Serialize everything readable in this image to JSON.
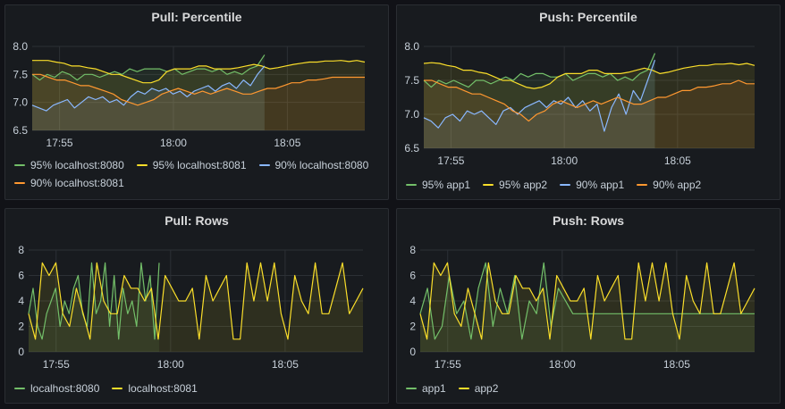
{
  "colors": {
    "green": "#73bf69",
    "yellow": "#fade2a",
    "cyan": "#8ab8ff",
    "orange": "#ff9830"
  },
  "chart_data": [
    {
      "type": "line",
      "title": "Pull: Percentile",
      "ylim": [
        6.5,
        8.0
      ],
      "y_ticks": [
        "8.0",
        "7.5",
        "7.0",
        "6.5"
      ],
      "y_tick_values": [
        8.0,
        7.5,
        7.0,
        6.5
      ],
      "x_ticks": [
        "17:55",
        "18:00",
        "18:05"
      ],
      "x_range_minutes": [
        -6.2,
        8.4
      ],
      "x_tick_minutes": [
        -5,
        0,
        5
      ],
      "grid": true,
      "legend_placement": "bottom",
      "series": [
        {
          "name": "95% localhost:8080",
          "color": "green",
          "x_end": 4.0,
          "values": [
            7.5,
            7.4,
            7.5,
            7.45,
            7.55,
            7.5,
            7.4,
            7.5,
            7.5,
            7.45,
            7.5,
            7.55,
            7.5,
            7.6,
            7.55,
            7.6,
            7.6,
            7.6,
            7.55,
            7.6,
            7.5,
            7.55,
            7.6,
            7.6,
            7.55,
            7.6,
            7.5,
            7.55,
            7.5,
            7.6,
            7.65,
            7.85
          ]
        },
        {
          "name": "95% localhost:8081",
          "color": "yellow",
          "x_end": 8.4,
          "values": [
            7.75,
            7.75,
            7.75,
            7.72,
            7.7,
            7.65,
            7.65,
            7.62,
            7.6,
            7.55,
            7.5,
            7.5,
            7.45,
            7.4,
            7.35,
            7.35,
            7.4,
            7.55,
            7.6,
            7.6,
            7.6,
            7.65,
            7.65,
            7.6,
            7.6,
            7.6,
            7.62,
            7.65,
            7.68,
            7.65,
            7.6,
            7.62,
            7.65,
            7.68,
            7.7,
            7.72,
            7.72,
            7.74,
            7.74,
            7.75,
            7.73,
            7.75,
            7.72
          ]
        },
        {
          "name": "90% localhost:8080",
          "color": "cyan",
          "x_end": 4.0,
          "values": [
            6.95,
            6.9,
            6.85,
            6.95,
            7.0,
            7.05,
            6.9,
            7.0,
            7.1,
            7.05,
            7.1,
            7.0,
            7.05,
            6.95,
            7.1,
            7.2,
            7.15,
            7.25,
            7.2,
            7.25,
            7.15,
            7.2,
            7.1,
            7.2,
            7.25,
            7.3,
            7.2,
            7.3,
            7.35,
            7.25,
            7.4,
            7.3,
            7.5,
            7.65
          ]
        },
        {
          "name": "90% localhost:8081",
          "color": "orange",
          "x_end": 8.4,
          "values": [
            7.5,
            7.5,
            7.45,
            7.4,
            7.4,
            7.35,
            7.3,
            7.3,
            7.25,
            7.2,
            7.15,
            7.05,
            7.0,
            6.95,
            7.0,
            7.05,
            7.15,
            7.2,
            7.25,
            7.2,
            7.15,
            7.2,
            7.15,
            7.2,
            7.25,
            7.2,
            7.15,
            7.15,
            7.2,
            7.25,
            7.25,
            7.3,
            7.35,
            7.35,
            7.4,
            7.4,
            7.42,
            7.45,
            7.45,
            7.45,
            7.45,
            7.45
          ]
        }
      ]
    },
    {
      "type": "line",
      "title": "Push: Percentile",
      "ylim": [
        6.5,
        8.0
      ],
      "y_ticks": [
        "8.0",
        "7.5",
        "7.0",
        "6.5"
      ],
      "y_tick_values": [
        8.0,
        7.5,
        7.0,
        6.5
      ],
      "x_ticks": [
        "17:55",
        "18:00",
        "18:05"
      ],
      "x_range_minutes": [
        -6.2,
        8.4
      ],
      "x_tick_minutes": [
        -5,
        0,
        5
      ],
      "grid": true,
      "legend_placement": "bottom",
      "series": [
        {
          "name": "95% app1",
          "color": "green",
          "x_end": 4.0,
          "values": [
            7.5,
            7.4,
            7.5,
            7.45,
            7.5,
            7.45,
            7.4,
            7.5,
            7.5,
            7.45,
            7.5,
            7.55,
            7.5,
            7.6,
            7.55,
            7.6,
            7.6,
            7.55,
            7.55,
            7.6,
            7.5,
            7.55,
            7.6,
            7.6,
            7.55,
            7.6,
            7.5,
            7.55,
            7.5,
            7.6,
            7.65,
            7.9
          ]
        },
        {
          "name": "95% app2",
          "color": "yellow",
          "x_end": 8.4,
          "values": [
            7.75,
            7.76,
            7.75,
            7.72,
            7.7,
            7.65,
            7.65,
            7.62,
            7.6,
            7.55,
            7.5,
            7.5,
            7.45,
            7.4,
            7.38,
            7.4,
            7.45,
            7.55,
            7.6,
            7.6,
            7.6,
            7.65,
            7.65,
            7.6,
            7.6,
            7.6,
            7.62,
            7.65,
            7.68,
            7.65,
            7.6,
            7.62,
            7.65,
            7.68,
            7.7,
            7.72,
            7.72,
            7.74,
            7.74,
            7.75,
            7.73,
            7.75,
            7.72
          ]
        },
        {
          "name": "90% app1",
          "color": "cyan",
          "x_end": 4.0,
          "values": [
            6.95,
            6.9,
            6.8,
            6.95,
            7.0,
            6.9,
            7.05,
            7.0,
            7.05,
            6.95,
            6.85,
            7.05,
            7.1,
            7.0,
            7.1,
            7.15,
            7.2,
            7.1,
            7.2,
            7.15,
            7.25,
            7.1,
            7.2,
            7.05,
            7.15,
            6.75,
            7.1,
            7.3,
            7.0,
            7.35,
            7.2,
            7.5,
            7.8
          ]
        },
        {
          "name": "90% app2",
          "color": "orange",
          "x_end": 8.4,
          "values": [
            7.5,
            7.5,
            7.45,
            7.4,
            7.4,
            7.35,
            7.3,
            7.3,
            7.25,
            7.2,
            7.15,
            7.05,
            7.0,
            6.9,
            7.0,
            7.05,
            7.15,
            7.2,
            7.15,
            7.1,
            7.15,
            7.2,
            7.15,
            7.2,
            7.25,
            7.2,
            7.15,
            7.15,
            7.2,
            7.25,
            7.25,
            7.3,
            7.35,
            7.35,
            7.4,
            7.4,
            7.42,
            7.45,
            7.45,
            7.5,
            7.45,
            7.45
          ]
        }
      ]
    },
    {
      "type": "line",
      "title": "Pull: Rows",
      "ylim": [
        0,
        8
      ],
      "y_ticks": [
        "8",
        "6",
        "4",
        "2",
        "0"
      ],
      "y_tick_values": [
        8,
        6,
        4,
        2,
        0
      ],
      "x_ticks": [
        "17:55",
        "18:00",
        "18:05"
      ],
      "x_range_minutes": [
        -6.2,
        8.4
      ],
      "x_tick_minutes": [
        -5,
        0,
        5
      ],
      "grid": true,
      "legend_placement": "bottom",
      "series": [
        {
          "name": "localhost:8080",
          "color": "green",
          "x_end": -0.5,
          "values": [
            3,
            5,
            2,
            1,
            3,
            4,
            5,
            2,
            4,
            3,
            5,
            6,
            3,
            2,
            7,
            3,
            4,
            7,
            2,
            6,
            1,
            5,
            3,
            4,
            2,
            7,
            4,
            6,
            1,
            7
          ]
        },
        {
          "name": "localhost:8081",
          "color": "yellow",
          "x_end": 8.4,
          "values": [
            3,
            1,
            7,
            6,
            7,
            3,
            2,
            5,
            3,
            1,
            7,
            4,
            3,
            3,
            6,
            5,
            5,
            4,
            5,
            1,
            6,
            5,
            4,
            4,
            5,
            1,
            6,
            4,
            5,
            6,
            1,
            1,
            7,
            4,
            7,
            4,
            7,
            3,
            1,
            6,
            4,
            3,
            7,
            3,
            3,
            5,
            7,
            3,
            4,
            5
          ]
        }
      ]
    },
    {
      "type": "line",
      "title": "Push: Rows",
      "ylim": [
        0,
        8
      ],
      "y_ticks": [
        "8",
        "6",
        "4",
        "2",
        "0"
      ],
      "y_tick_values": [
        8,
        6,
        4,
        2,
        0
      ],
      "x_ticks": [
        "17:55",
        "18:00",
        "18:05"
      ],
      "x_range_minutes": [
        -6.2,
        8.4
      ],
      "x_tick_minutes": [
        -5,
        0,
        5
      ],
      "grid": true,
      "legend_placement": "bottom",
      "series": [
        {
          "name": "app1",
          "color": "green",
          "x_end": 8.4,
          "values": [
            3,
            5,
            1,
            2,
            6,
            3,
            4,
            1,
            5,
            7,
            2,
            5,
            3,
            6,
            1,
            4,
            3,
            7,
            2,
            5,
            4,
            3,
            3,
            3,
            3,
            3,
            3,
            3,
            3,
            3,
            3,
            3,
            3,
            3,
            3,
            3,
            3,
            3,
            3,
            3,
            3,
            3,
            3,
            3,
            3,
            3,
            3
          ]
        },
        {
          "name": "app2",
          "color": "yellow",
          "x_end": 8.4,
          "values": [
            3,
            1,
            7,
            6,
            7,
            3,
            2,
            5,
            3,
            1,
            7,
            4,
            3,
            3,
            6,
            5,
            5,
            4,
            5,
            1,
            6,
            5,
            4,
            4,
            5,
            1,
            6,
            4,
            5,
            6,
            1,
            1,
            7,
            4,
            7,
            4,
            7,
            3,
            1,
            6,
            4,
            3,
            7,
            3,
            3,
            5,
            7,
            3,
            4,
            5
          ]
        }
      ]
    }
  ]
}
